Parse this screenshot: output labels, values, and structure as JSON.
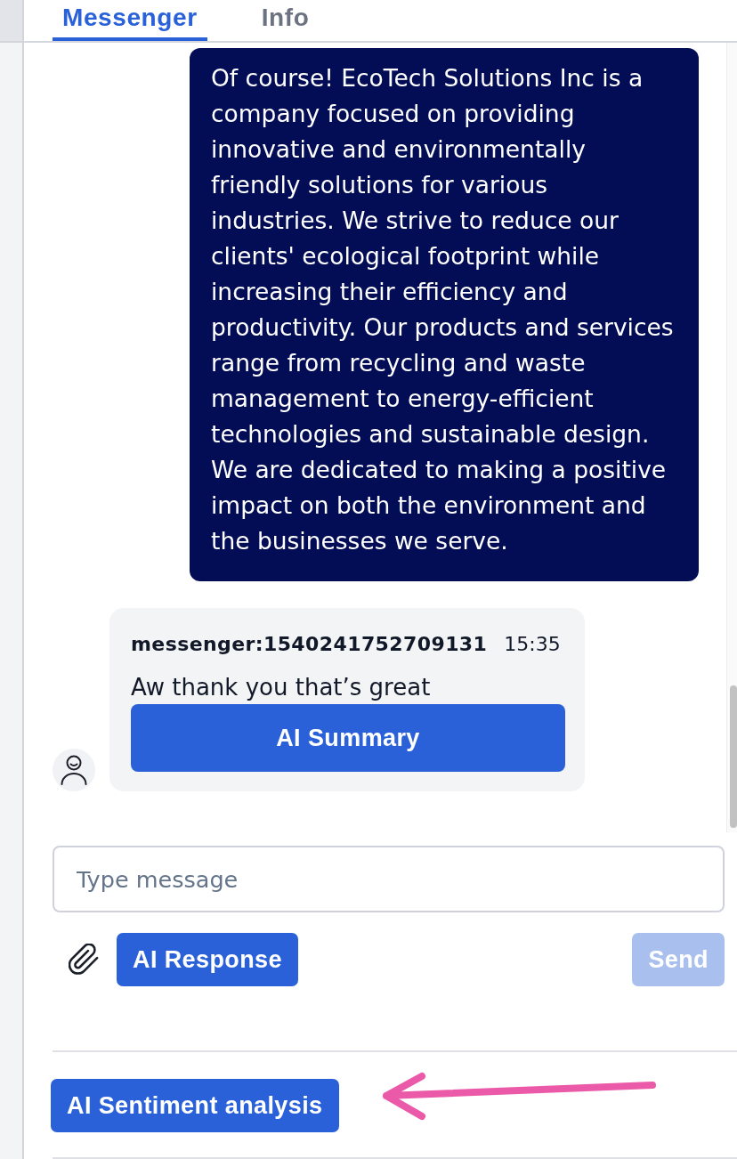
{
  "tabs": [
    {
      "label": "Messenger",
      "selected": true
    },
    {
      "label": "Info",
      "selected": false
    }
  ],
  "messages": [
    {
      "kind": "outgoing",
      "text": "Of course! EcoTech Solutions Inc is a company focused on providing innovative and environmentally friendly solutions for various industries. We strive to reduce our clients' ecological footprint while increasing their efficiency and productivity. Our products and services range from recycling and waste management to energy-efficient technologies and sustainable design. We are dedicated to making a positive impact on both the environment and the businesses we serve."
    },
    {
      "kind": "incoming",
      "sender": "messenger:1540241752709131",
      "time": "15:35",
      "text": "Aw thank you that’s great",
      "action": "AI Summary"
    }
  ],
  "composer": {
    "placeholder": "Type message",
    "buttons": [
      {
        "kind": "action",
        "label": "AI Response",
        "disabled": false
      },
      {
        "kind": "send",
        "label": "Send",
        "disabled": true
      }
    ]
  },
  "sentiment_button": {
    "label": "AI Sentiment analysis"
  }
}
